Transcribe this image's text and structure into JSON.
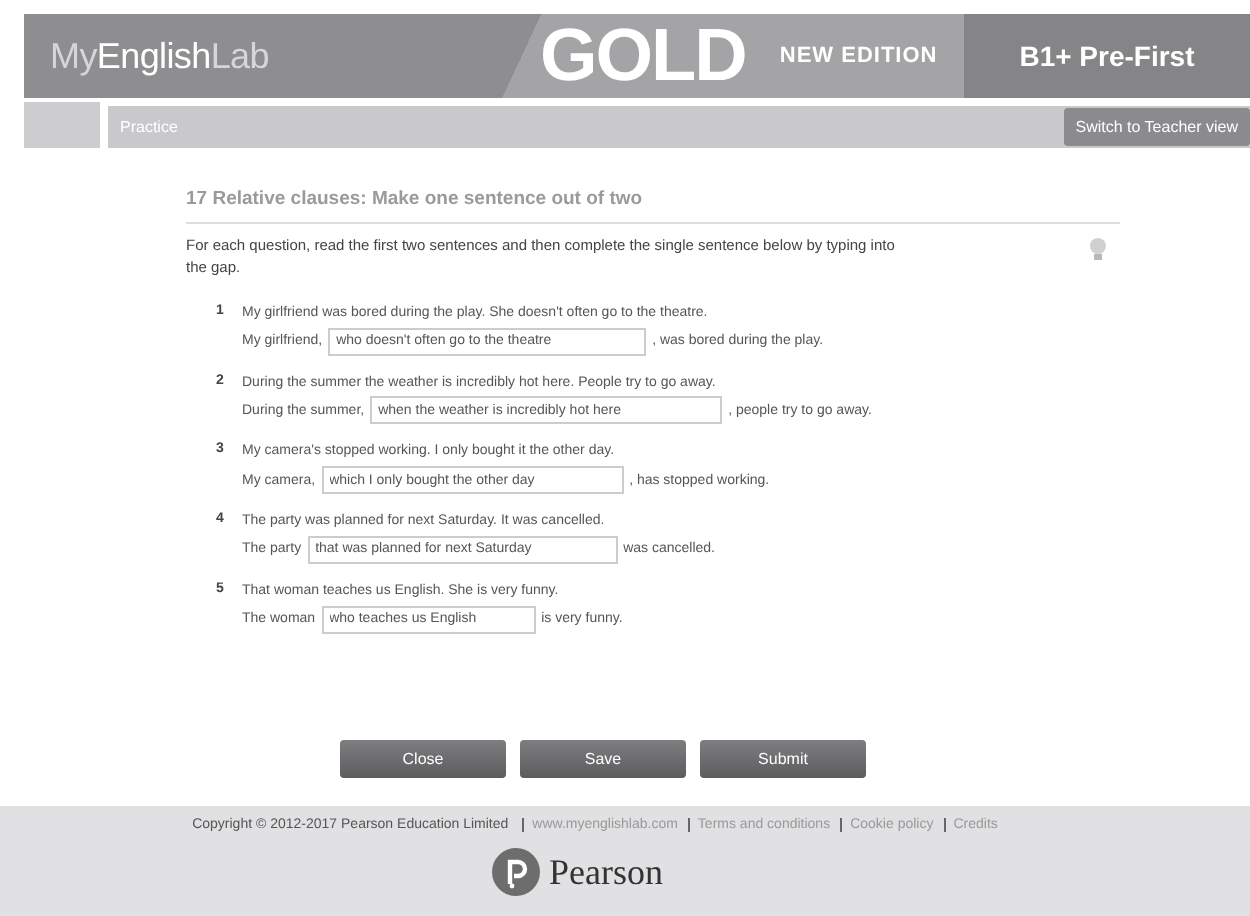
{
  "header": {
    "logo": [
      {
        "text": "My",
        "highlight": false
      },
      {
        "text": "English",
        "highlight": true
      },
      {
        "text": "Lab",
        "highlight": false
      }
    ],
    "brand": "GOLD",
    "edition": "NEW EDITION",
    "level": "B1+ Pre-First"
  },
  "subbar": {
    "title": "Practice",
    "button": "Switch to Teacher view"
  },
  "exercise": {
    "title": "17 Relative clauses: Make one sentence out of two",
    "instruction": "For each question, read the first two sentences and then complete the single sentence below by typing into the gap.",
    "items": [
      {
        "number": "1",
        "prompt": "My girlfriend was bored during the play. She doesn't often go to the theatre.",
        "before": "My girlfriend,",
        "answer": "who doesn't often go to the theatre",
        "after": ", was bored during the play."
      },
      {
        "number": "2",
        "prompt": "During the summer the weather is incredibly hot here. People try to go away.",
        "before": "During the summer,",
        "answer": "when the weather is incredibly hot here",
        "after": ", people try to go away."
      },
      {
        "number": "3",
        "prompt": "My camera's stopped working. I only bought it the other day.",
        "before": "My camera,",
        "answer": "which I only bought the other day",
        "after": ", has stopped working."
      },
      {
        "number": "4",
        "prompt": "The party was planned for next Saturday. It was cancelled.",
        "before": "The party",
        "answer": "that was planned for next Saturday",
        "after": "was cancelled."
      },
      {
        "number": "5",
        "prompt": "That woman teaches us English. She is very funny.",
        "before": "The woman",
        "answer": "who teaches us English",
        "after": "is very funny."
      }
    ]
  },
  "buttons": [
    "Close",
    "Save",
    "Submit"
  ],
  "footer": {
    "copyright": "Copyright © 2012-2017 Pearson Education Limited",
    "links": [
      "www.myenglishlab.com",
      "Terms and conditions",
      "Cookie policy",
      "Credits"
    ],
    "brand": "Pearson"
  }
}
